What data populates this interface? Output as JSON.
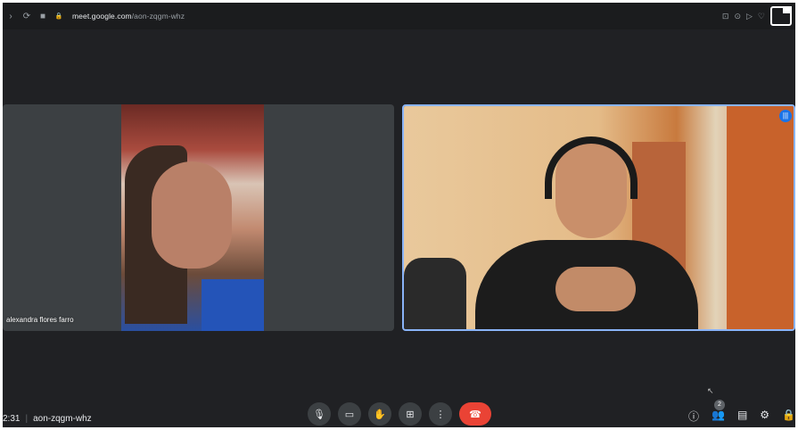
{
  "browser": {
    "nav_back": "‹",
    "nav_forward": "›",
    "reload": "⟳",
    "camera_indicator": "■",
    "lock_icon": "🔒",
    "url_domain": "meet.google.com",
    "url_path": "/aon-zqgm-whz",
    "right_icons": [
      "⊡",
      "⊙",
      "▷",
      "♡"
    ]
  },
  "participants": [
    {
      "name": "alexandra flores farro"
    },
    {
      "name": ""
    }
  ],
  "meeting": {
    "time": "2:31",
    "separator": "|",
    "code": "aon-zqgm-whz"
  },
  "controls": {
    "mic": "🎙",
    "camera": "▭",
    "raise_hand": "✋",
    "present": "⊞",
    "more": "⋮",
    "end_call": "☎"
  },
  "right_controls": {
    "info": "ⓘ",
    "people": "👥",
    "people_count": "2",
    "chat": "▤",
    "activities": "⚙",
    "host": "🔒"
  },
  "speaking_indicator": "|||"
}
